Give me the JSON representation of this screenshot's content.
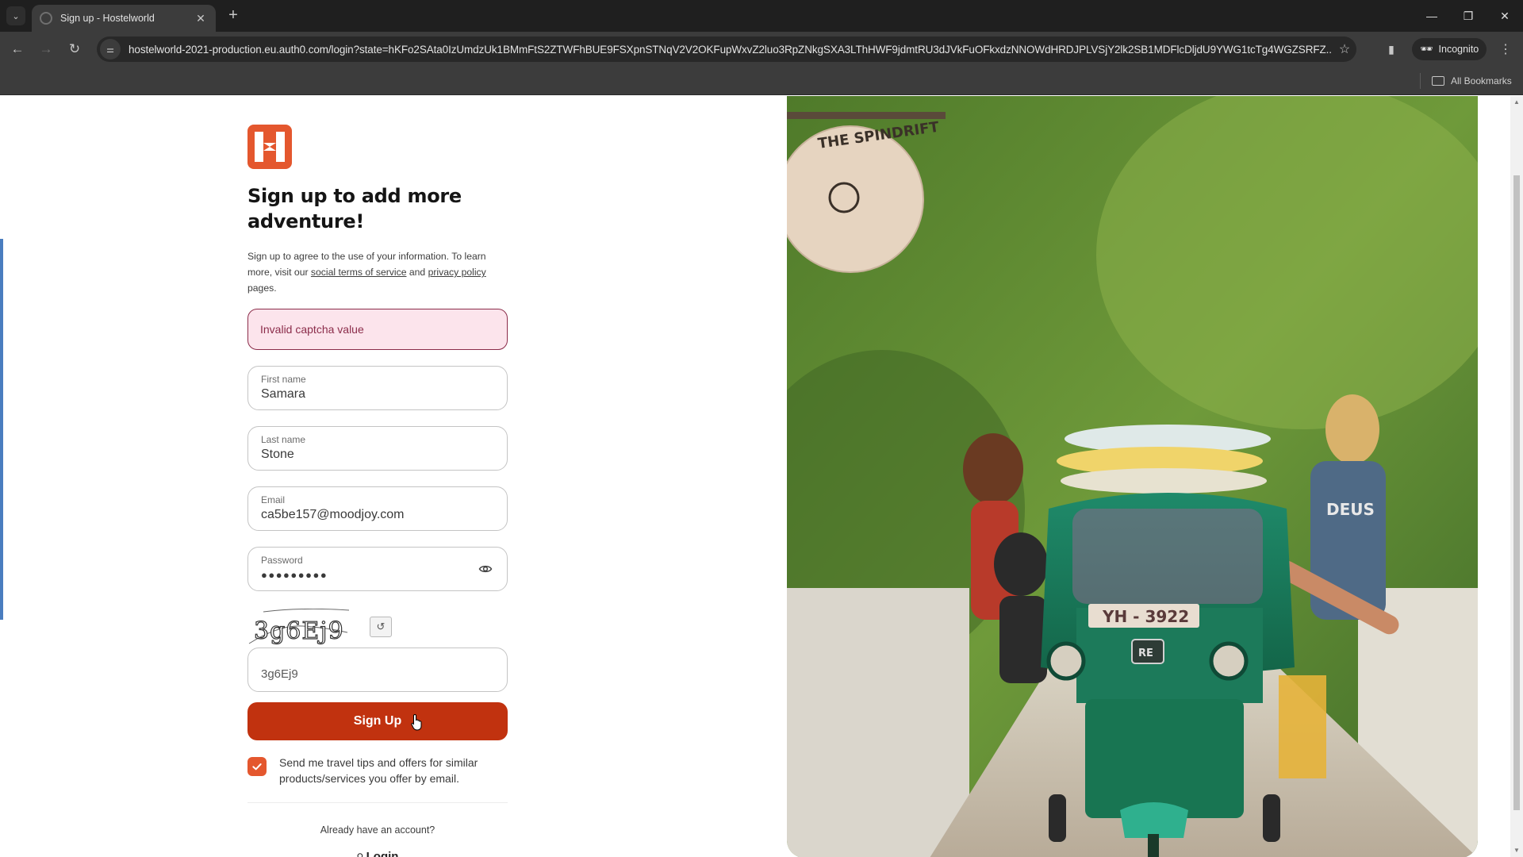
{
  "browser": {
    "tab_title": "Sign up - Hostelworld",
    "url": "hostelworld-2021-production.eu.auth0.com/login?state=hKFo2SAta0IzUmdzUk1BMmFtS2ZTWFhBUE9FSXpnSTNqV2V2OKFupWxvZ2luo3RpZNkgSXA3LThHWF9jdmtRU3dJVkFuOFkxdzNNOWdHRDJPLVSjY2lk2SB1MDFlcDljdU9YWG1tcTg4WGZSRFZ...",
    "incognito_label": "Incognito",
    "bookmarks_label": "All Bookmarks",
    "icons": {
      "tab_search": "chevron-down-icon",
      "favicon": "globe-icon",
      "close_tab": "close-icon",
      "new_tab": "plus-icon",
      "back": "arrow-left-icon",
      "forward": "arrow-right-icon",
      "reload": "reload-icon",
      "site_info": "tune-icon",
      "bookmark": "star-icon",
      "side_panel": "side-panel-icon",
      "incognito": "incognito-icon",
      "menu": "kebab-menu-icon",
      "folder": "folder-icon",
      "minimize": "minimize-icon",
      "restore": "restore-icon",
      "close_window": "close-icon"
    }
  },
  "signup": {
    "heading": "Sign up to add more adventure!",
    "description": {
      "part1": "Sign up to agree to the use of your information. To learn more, visit our ",
      "terms_link": "social terms of service",
      "part2": " and ",
      "privacy_link": "privacy policy",
      "part3": " pages."
    },
    "error_message": "Invalid captcha value",
    "fields": {
      "first_name": {
        "label": "First name",
        "value": "Samara"
      },
      "last_name": {
        "label": "Last name",
        "value": "Stone"
      },
      "email": {
        "label": "Email",
        "value": "ca5be157@moodjoy.com"
      },
      "password": {
        "label": "Password",
        "masked_value": "●●●●●●●●●"
      }
    },
    "captcha": {
      "image_text": "3g6Ej9",
      "input_value": "3g6Ej9",
      "refresh_symbol": "↺"
    },
    "submit_label": "Sign Up",
    "consent": {
      "checked": true,
      "text": "Send me travel tips and offers for similar products/services you offer by email."
    },
    "already_account": "Already have an account?",
    "login_label": "Login"
  },
  "hero_image": {
    "description": "Friends riding a green tuk-tuk with surfboards under a Spindrift sign",
    "sign_text": "THE SPINDRIFT",
    "plate_text": "YH - 3922",
    "badge_text": "RE",
    "shirt_text": "DEUS"
  },
  "colors": {
    "brand": "#e4572e",
    "button": "#c1320f",
    "error_bg": "#fce4ec",
    "error_text": "#8b2c4a"
  }
}
